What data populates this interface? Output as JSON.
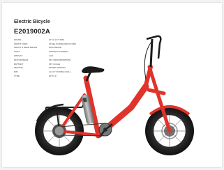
{
  "document": {
    "category": "Electric Bicycle",
    "model": "E2019002A"
  },
  "specs": [
    {
      "label": "FRAME",
      "value": "20\" ALLOY 6061"
    },
    {
      "label": "FRONT FORK",
      "value": "STEEL SUSPENSION FORK"
    },
    {
      "label": "FRONT & REAR BRAKE",
      "value": "DISC BRAKE"
    },
    {
      "label": "SHIFT",
      "value": "SHIMANO 6 SPEED"
    },
    {
      "label": "DISPLAY",
      "value": "LCD"
    },
    {
      "label": "MOTOR REAR",
      "value": "36V 250W/350W/500W"
    },
    {
      "label": "BATTERY",
      "value": "36V 10.4AH"
    },
    {
      "label": "SENSOR",
      "value": "SPEED SENSOR"
    },
    {
      "label": "RIM",
      "value": "ALLOY DOUBLE WALL"
    },
    {
      "label": "TYRE",
      "value": "20\"X4.0"
    }
  ],
  "colors": {
    "frame": "#e0332b",
    "tire": "#1e1e1e",
    "battery": "#9a9a9a"
  }
}
